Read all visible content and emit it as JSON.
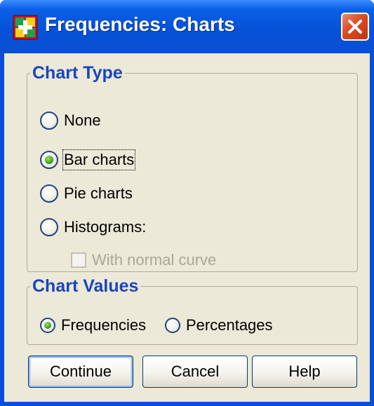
{
  "window": {
    "title": "Frequencies: Charts"
  },
  "chart_type": {
    "label": "Chart Type",
    "options": [
      {
        "label": "None",
        "selected": false
      },
      {
        "label": "Bar charts",
        "selected": true
      },
      {
        "label": "Pie charts",
        "selected": false
      },
      {
        "label": "Histograms:",
        "selected": false
      }
    ],
    "normal_curve": {
      "label": "With normal curve",
      "checked": false,
      "enabled": false
    }
  },
  "chart_values": {
    "label": "Chart Values",
    "options": [
      {
        "label": "Frequencies",
        "selected": true
      },
      {
        "label": "Percentages",
        "selected": false
      }
    ]
  },
  "buttons": {
    "continue": "Continue",
    "cancel": "Cancel",
    "help": "Help"
  },
  "colors": {
    "titlebar": "#0552d9",
    "dialog_bg": "#ece9d8",
    "group_title": "#1a45bc",
    "radio_selected": "#3aa31a",
    "close_button": "#dd4a22"
  },
  "icons": {
    "app": "spss-app-icon",
    "close": "close-icon"
  }
}
